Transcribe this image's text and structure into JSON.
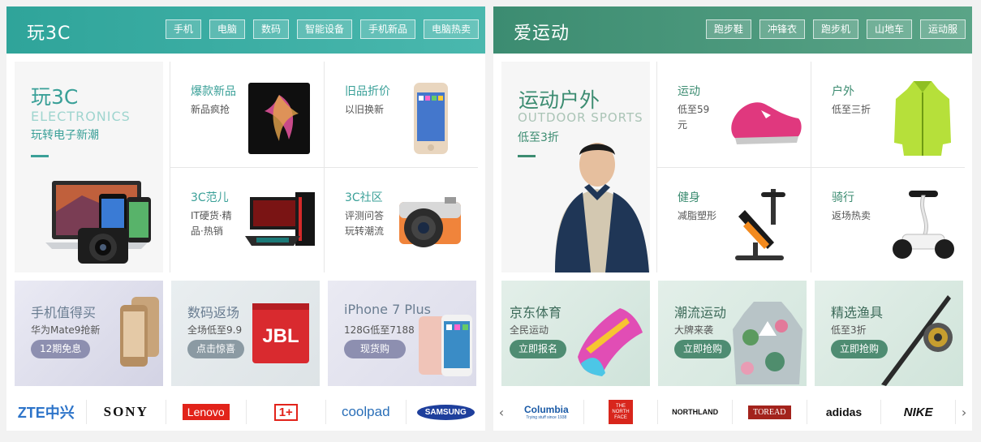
{
  "left": {
    "title": "玩3C",
    "tags": [
      "手机",
      "电脑",
      "数码",
      "智能设备",
      "手机新品",
      "电脑热卖"
    ],
    "feature": {
      "title": "玩3C",
      "subtitle": "ELECTRONICS",
      "desc": "玩转电子新潮"
    },
    "cells": [
      {
        "title": "爆款新品",
        "desc": "新品疯抢"
      },
      {
        "title": "旧品折价",
        "desc": "以旧换新"
      },
      {
        "title": "3C范儿",
        "desc": "IT硬货·精品·热销"
      },
      {
        "title": "3C社区",
        "desc": "评测问答玩转潮流"
      }
    ],
    "promos": [
      {
        "title": "手机值得买",
        "desc": "华为Mate9抢新",
        "button": "12期免息"
      },
      {
        "title": "数码返场",
        "desc": "全场低至9.9",
        "button": "点击惊喜"
      },
      {
        "title": "iPhone 7 Plus",
        "desc": "128G低至7188",
        "button": "现货购"
      }
    ],
    "brands": [
      "ZTE中兴",
      "SONY",
      "Lenovo",
      "1+",
      "coolpad",
      "SAMSUNG"
    ]
  },
  "right": {
    "title": "爱运动",
    "tags": [
      "跑步鞋",
      "冲锋衣",
      "跑步机",
      "山地车",
      "运动服"
    ],
    "feature": {
      "title": "运动户外",
      "subtitle": "OUTDOOR SPORTS",
      "desc": "低至3折"
    },
    "cells": [
      {
        "title": "运动",
        "desc": "低至59元"
      },
      {
        "title": "户外",
        "desc": "低至三折"
      },
      {
        "title": "健身",
        "desc": "减脂塑形"
      },
      {
        "title": "骑行",
        "desc": "返场热卖"
      }
    ],
    "promos": [
      {
        "title": "京东体育",
        "desc": "全民运动",
        "button": "立即报名"
      },
      {
        "title": "潮流运动",
        "desc": "大牌来袭",
        "button": "立即抢购"
      },
      {
        "title": "精选渔具",
        "desc": "低至3折",
        "button": "立即抢购"
      }
    ],
    "brands": [
      "Columbia",
      "THE NORTH FACE",
      "NORTHLAND",
      "TOREAD",
      "adidas",
      "NIKE"
    ],
    "brand_sub": "Trying stuff since 1938",
    "arrows": {
      "prev": "‹",
      "next": "›"
    }
  }
}
